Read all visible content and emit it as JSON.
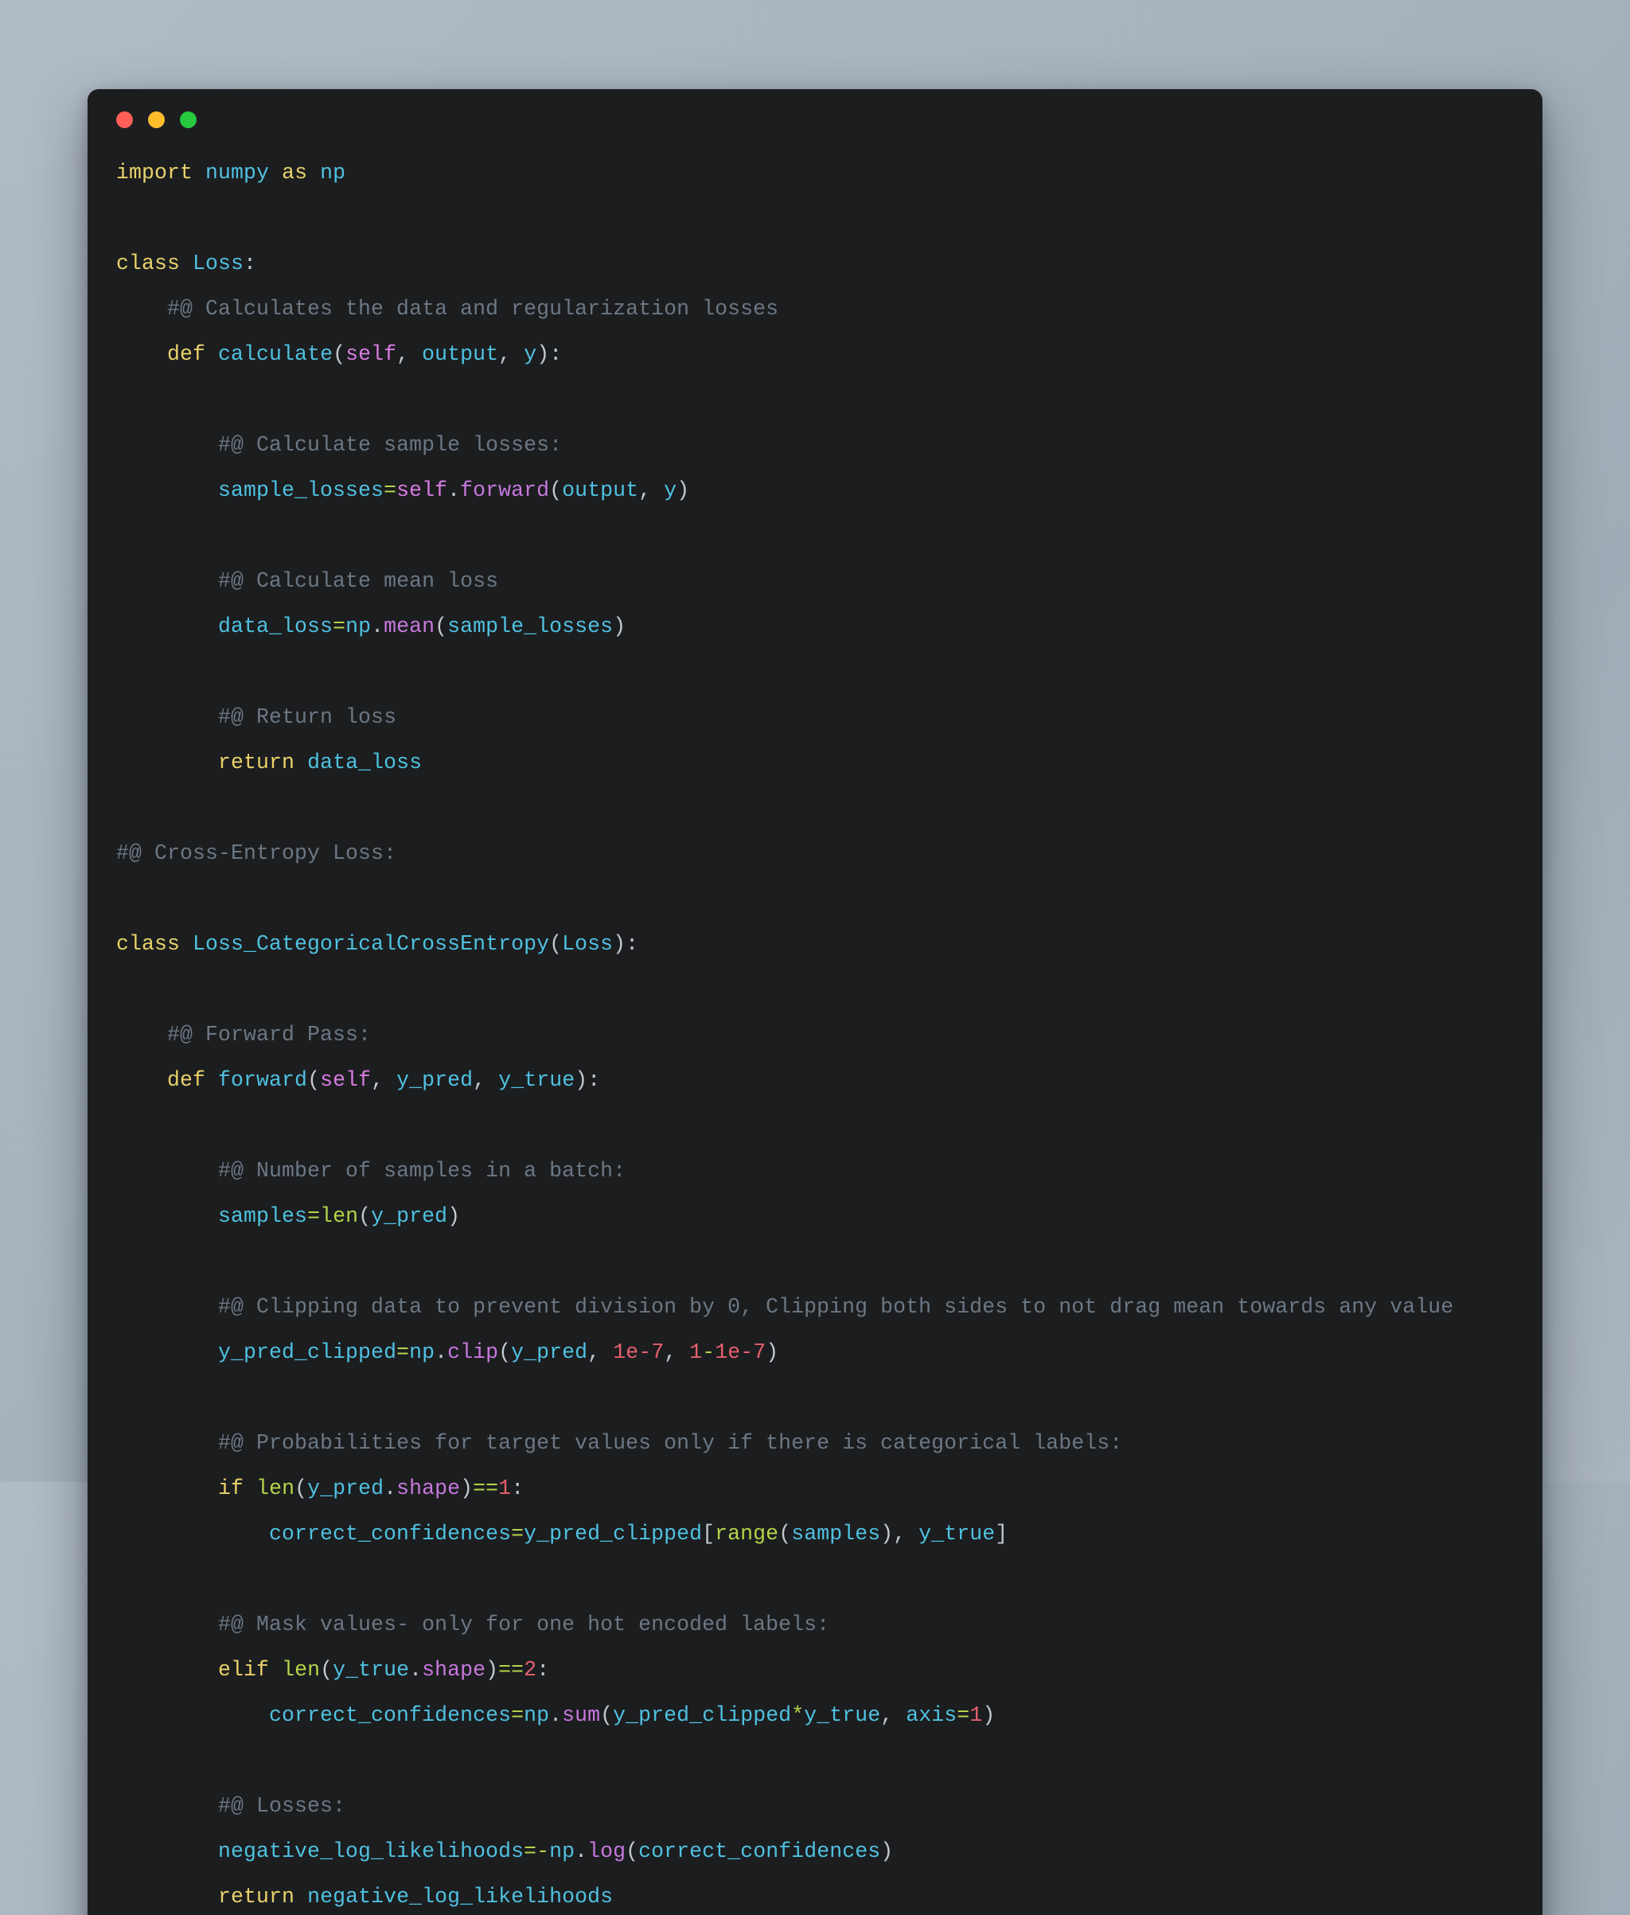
{
  "window": {
    "traffic_lights": [
      {
        "name": "close",
        "color": "#ff5f56"
      },
      {
        "name": "minimize",
        "color": "#ffbd2e"
      },
      {
        "name": "maximize",
        "color": "#27c93f"
      }
    ],
    "background_color": "#1c1d1f",
    "page_background": "#a8b3bd"
  },
  "theme": {
    "keyword": "#e8d26a",
    "name": "#4fc1e0",
    "self": "#d77be0",
    "attribute": "#c678dd",
    "builtin": "#b5d44a",
    "operator": "#b5d44a",
    "number": "#e4606d",
    "comment": "#6b7884",
    "punctuation": "#c3c8cf",
    "default_text": "#c8cdd4"
  },
  "code": {
    "language": "python",
    "lines": [
      "import numpy as np",
      "",
      "class Loss:",
      "    #@ Calculates the data and regularization losses",
      "    def calculate(self, output, y):",
      "",
      "        #@ Calculate sample losses:",
      "        sample_losses=self.forward(output, y)",
      "",
      "        #@ Calculate mean loss",
      "        data_loss=np.mean(sample_losses)",
      "",
      "        #@ Return loss",
      "        return data_loss",
      "",
      "#@ Cross-Entropy Loss:",
      "",
      "class Loss_CategoricalCrossEntropy(Loss):",
      "",
      "    #@ Forward Pass:",
      "    def forward(self, y_pred, y_true):",
      "",
      "        #@ Number of samples in a batch:",
      "        samples=len(y_pred)",
      "",
      "        #@ Clipping data to prevent division by 0, Clipping both sides to not drag mean towards any value",
      "        y_pred_clipped=np.clip(y_pred, 1e-7, 1-1e-7)",
      "",
      "        #@ Probabilities for target values only if there is categorical labels:",
      "        if len(y_pred.shape)==1:",
      "            correct_confidences=y_pred_clipped[range(samples), y_true]",
      "",
      "        #@ Mask values- only for one hot encoded labels:",
      "        elif len(y_true.shape)==2:",
      "            correct_confidences=np.sum(y_pred_clipped*y_true, axis=1)",
      "",
      "        #@ Losses:",
      "        negative_log_likelihoods=-np.log(correct_confidences)",
      "        return negative_log_likelihoods"
    ],
    "tokens": {
      "keywords": [
        "import",
        "as",
        "class",
        "def",
        "return",
        "if",
        "elif"
      ],
      "builtins": [
        "len",
        "range"
      ],
      "numbers": [
        "1e-7",
        "1-1e-7",
        "0",
        "1",
        "2"
      ],
      "comments": [
        "#@ Calculates the data and regularization losses",
        "#@ Calculate sample losses:",
        "#@ Calculate mean loss",
        "#@ Return loss",
        "#@ Cross-Entropy Loss:",
        "#@ Forward Pass:",
        "#@ Number of samples in a batch:",
        "#@ Clipping data to prevent division by 0, Clipping both sides to not drag mean towards any value",
        "#@ Probabilities for target values only if there is categorical labels:",
        "#@ Mask values- only for one hot encoded labels:",
        "#@ Losses:"
      ],
      "identifiers": [
        "numpy",
        "np",
        "Loss",
        "calculate",
        "self",
        "output",
        "y",
        "sample_losses",
        "forward",
        "mean",
        "data_loss",
        "Loss_CategoricalCrossEntropy",
        "y_pred",
        "y_true",
        "samples",
        "y_pred_clipped",
        "clip",
        "shape",
        "correct_confidences",
        "sum",
        "axis",
        "log",
        "negative_log_likelihoods"
      ]
    }
  }
}
